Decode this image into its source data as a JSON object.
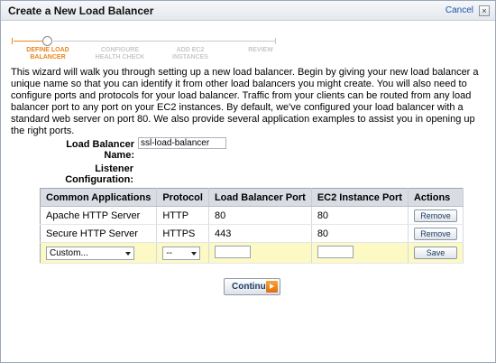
{
  "dialog": {
    "title": "Create a New Load Balancer",
    "cancel_label": "Cancel",
    "close_glyph": "×"
  },
  "wizard": {
    "steps": [
      {
        "line1": "DEFINE LOAD",
        "line2": "BALANCER",
        "active": true
      },
      {
        "line1": "CONFIGURE",
        "line2": "HEALTH CHECK",
        "active": false
      },
      {
        "line1": "ADD EC2",
        "line2": "INSTANCES",
        "active": false
      },
      {
        "line1": "REVIEW",
        "line2": "",
        "active": false
      }
    ]
  },
  "intro_text": "This wizard will walk you through setting up a new load balancer. Begin by giving your new load balancer a unique name so that you can identify it from other load balancers you might create. You will also need to configure ports and protocols for your load balancer. Traffic from your clients can be routed from any load balancer port to any port on your EC2 instances. By default, we've configured your load balancer with a standard web server on port 80. We also provide several application examples to assist you in opening up the right ports.",
  "form": {
    "lb_name_label": "Load Balancer Name:",
    "lb_name_value": "ssl-load-balancer",
    "listener_label_line1": "Listener",
    "listener_label_line2": "Configuration:"
  },
  "listeners": {
    "headers": [
      "Common Applications",
      "Protocol",
      "Load Balancer Port",
      "EC2 Instance Port",
      "Actions"
    ],
    "rows": [
      {
        "application": "Apache HTTP Server",
        "protocol": "HTTP",
        "lb_port": "80",
        "instance_port": "80",
        "action": "Remove"
      },
      {
        "application": "Secure HTTP Server",
        "protocol": "HTTPS",
        "lb_port": "443",
        "instance_port": "80",
        "action": "Remove"
      }
    ],
    "new_row": {
      "application_select": "Custom...",
      "protocol_select": "--",
      "lb_port": "",
      "instance_port": "",
      "action": "Save"
    }
  },
  "footer": {
    "continue_label": "Continue"
  },
  "colors": {
    "accent_orange": "#e8861a",
    "new_row_bg": "#fdf9c5",
    "header_bg": "#d9dde3"
  }
}
